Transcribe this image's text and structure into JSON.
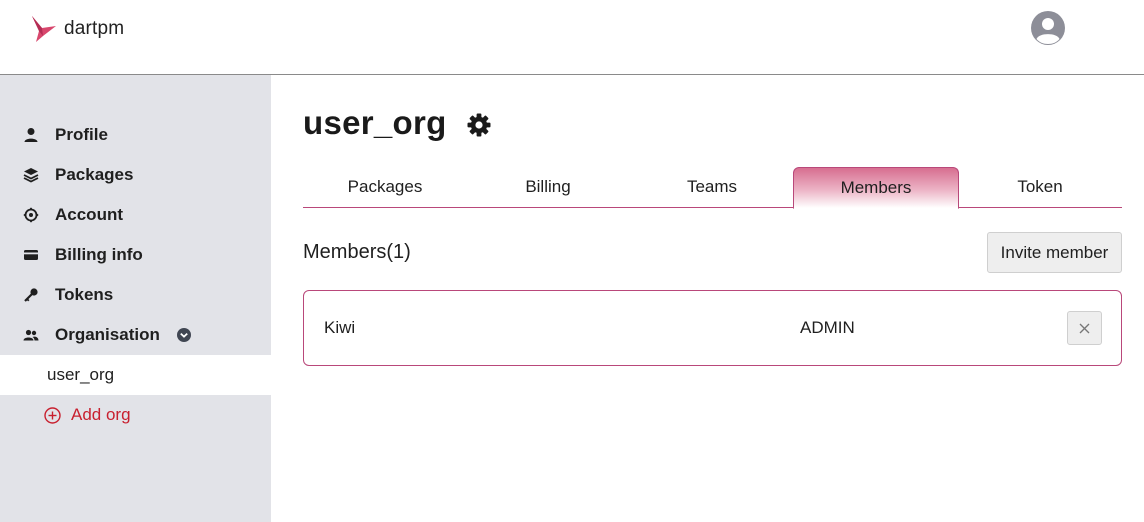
{
  "header": {
    "brand": "dartpm",
    "icons": {
      "logo": "dartpm-bird-logo",
      "avatar": "user-avatar-icon"
    }
  },
  "sidebar": {
    "items": [
      {
        "label": "Profile",
        "icon": "person-icon"
      },
      {
        "label": "Packages",
        "icon": "layers-icon"
      },
      {
        "label": "Account",
        "icon": "account-gear-icon"
      },
      {
        "label": "Billing info",
        "icon": "credit-card-icon"
      },
      {
        "label": "Tokens",
        "icon": "key-icon"
      },
      {
        "label": "Organisation",
        "icon": "people-icon",
        "expanded": true
      }
    ],
    "org_items": [
      {
        "label": "user_org",
        "active": true
      }
    ],
    "add_org_label": "Add org"
  },
  "main": {
    "title": "user_org",
    "tabs": [
      {
        "label": "Packages",
        "active": false
      },
      {
        "label": "Billing",
        "active": false
      },
      {
        "label": "Teams",
        "active": false
      },
      {
        "label": "Members",
        "active": true
      },
      {
        "label": "Token",
        "active": false
      }
    ],
    "members_heading": "Members(1)",
    "invite_label": "Invite member",
    "members": [
      {
        "name": "Kiwi",
        "role": "ADMIN"
      }
    ]
  },
  "colors": {
    "accent": "#b9487a",
    "accent_red": "#c8202f",
    "sidebar_bg": "#e2e3e8"
  }
}
